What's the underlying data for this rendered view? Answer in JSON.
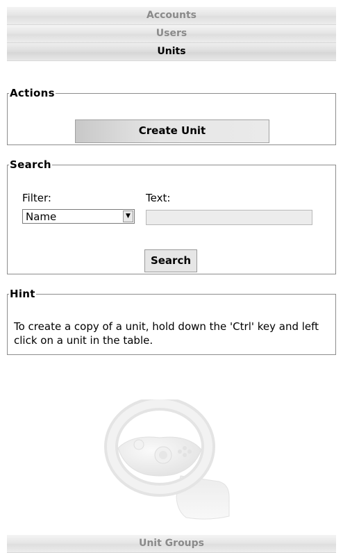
{
  "accordion": {
    "accounts": "Accounts",
    "users": "Users",
    "units": "Units",
    "unit_groups": "Unit Groups"
  },
  "actions": {
    "legend": "Actions",
    "create_label": "Create Unit"
  },
  "search": {
    "legend": "Search",
    "filter_label": "Filter:",
    "filter_value": "Name",
    "text_label": "Text:",
    "text_value": "",
    "button_label": "Search"
  },
  "hint": {
    "legend": "Hint",
    "text": "To create a copy of a unit, hold down the 'Ctrl' key and left click on a unit in the table."
  },
  "illustration": {
    "icon": "steering-wheel-icon"
  }
}
